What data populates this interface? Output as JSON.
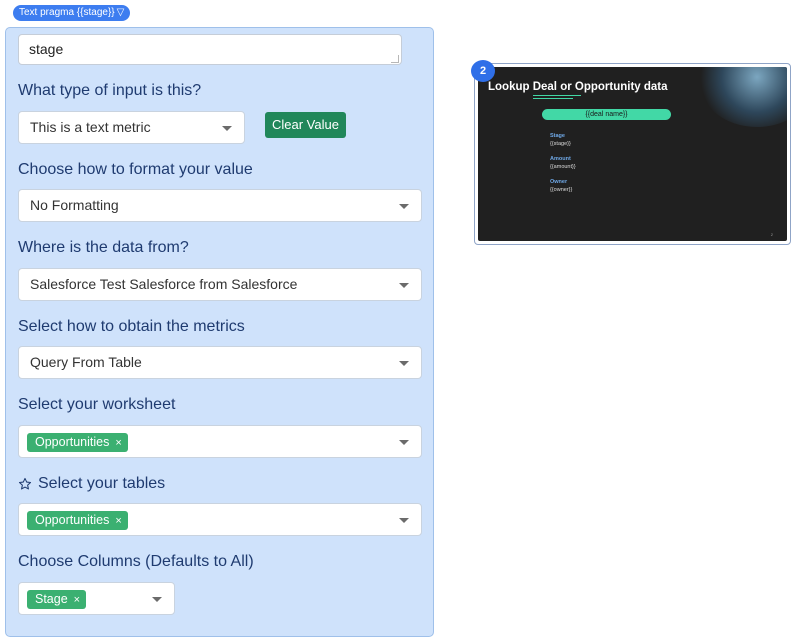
{
  "pill": {
    "label": "Text pragma {{stage}}",
    "caret": "▽"
  },
  "form": {
    "textarea_value": "stage",
    "q_input_type": "What type of input is this?",
    "input_type_value": "This is a text metric",
    "clear_button": "Clear Value",
    "q_format": "Choose how to format your value",
    "format_value": "No Formatting",
    "q_source": "Where is the data from?",
    "source_value": "Salesforce Test Salesforce from Salesforce",
    "q_method": "Select how to obtain the metrics",
    "method_value": "Query From Table",
    "q_worksheet": "Select your worksheet",
    "worksheet_tag": "Opportunities",
    "q_tables": "Select your tables",
    "tables_tag": "Opportunities",
    "q_columns": "Choose Columns (Defaults to All)",
    "columns_tag": "Stage",
    "tag_remove": "×"
  },
  "preview": {
    "slide_number": "2",
    "title": "Lookup Deal or Opportunity data",
    "deal_field": "{{deal name}}",
    "fields": [
      {
        "label": "Stage",
        "value": "{{stage}}"
      },
      {
        "label": "Amount",
        "value": "{{amount}}"
      },
      {
        "label": "Owner",
        "value": "{{owner}}"
      }
    ],
    "page_marker": "2"
  },
  "colors": {
    "panel": "#cfe2fb",
    "accent": "#3d7df0",
    "tag": "#3bb071",
    "button": "#21875a",
    "slide_bg": "#202020",
    "slide_accent": "#42d8a6"
  }
}
